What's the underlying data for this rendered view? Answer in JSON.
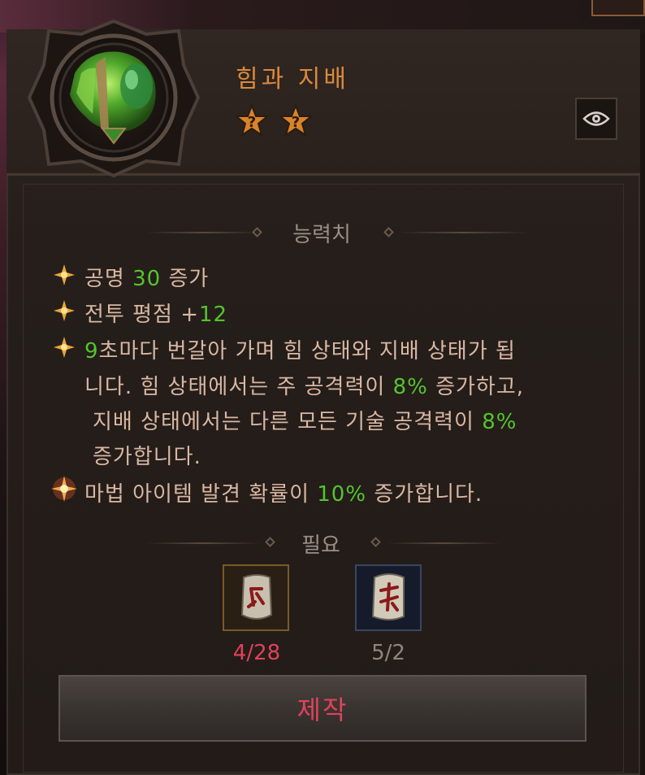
{
  "item": {
    "title": "힘과 지배",
    "stars": [
      "?",
      "?"
    ]
  },
  "eye_button": {
    "icon": "eye-icon"
  },
  "stats_section": {
    "heading": "능력치",
    "lines": [
      {
        "pre": "공명 ",
        "value": "30",
        "post": " 증가"
      },
      {
        "pre": "전투 평점 +",
        "value": "12",
        "post": ""
      }
    ],
    "effect": {
      "l1_value": "9",
      "l1_rest": "초마다 번갈아 가며 힘 상태와 지배 상태가 됩",
      "l2_pre": "니다. 힘 상태에서는 주 공격력이 ",
      "l2_value": "8%",
      "l2_post": " 증가하고,",
      "l3_pre": "지배 상태에서는 다른 모든 기술 공격력이 ",
      "l3_value": "8%",
      "l4": "증가합니다."
    },
    "magic": {
      "pre": "마법 아이템 발견 확률이 ",
      "value": "10%",
      "post": " 증가합니다."
    }
  },
  "requirements": {
    "heading": "필요",
    "runes": [
      {
        "count": "4/28",
        "status": "insufficient",
        "color": "#e0425a"
      },
      {
        "count": "5/2",
        "status": "sufficient",
        "color": "#8f857c"
      }
    ]
  },
  "craft_button": {
    "label": "제작"
  },
  "colors": {
    "title": "#d98a3c",
    "stat_text": "#d9b7a3",
    "highlight": "#54c42f",
    "craft": "#e0425a"
  }
}
